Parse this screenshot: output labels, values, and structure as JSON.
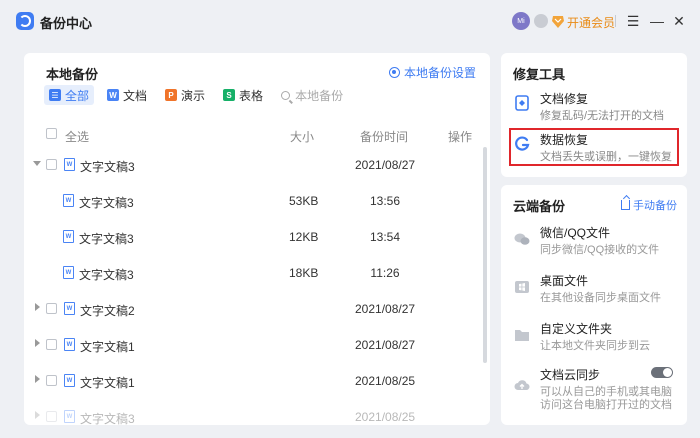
{
  "titlebar": {
    "app_title": "备份中心",
    "avatar_text": "Mi",
    "vip_label": "开通会员",
    "menu_glyph": "☰",
    "minimize_glyph": "—",
    "close_glyph": "✕"
  },
  "local_backup": {
    "title": "本地备份",
    "settings_label": "本地备份设置",
    "filters": [
      {
        "label": "全部",
        "icon_text": "☰"
      },
      {
        "label": "文档",
        "icon_text": "W"
      },
      {
        "label": "演示",
        "icon_text": "P"
      },
      {
        "label": "表格",
        "icon_text": "S"
      }
    ],
    "search_placeholder": "本地备份",
    "columns": {
      "select_all": "全选",
      "size": "大小",
      "time": "备份时间",
      "action": "操作"
    },
    "doc_icon_text": "W",
    "rows": [
      {
        "name": "文字文稿3",
        "size": "",
        "time": "2021/08/27"
      },
      {
        "name": "文字文稿3",
        "size": "53KB",
        "time": "13:56"
      },
      {
        "name": "文字文稿3",
        "size": "12KB",
        "time": "13:54"
      },
      {
        "name": "文字文稿3",
        "size": "18KB",
        "time": "11:26"
      },
      {
        "name": "文字文稿2",
        "size": "",
        "time": "2021/08/27"
      },
      {
        "name": "文字文稿1",
        "size": "",
        "time": "2021/08/27"
      },
      {
        "name": "文字文稿1",
        "size": "",
        "time": "2021/08/25"
      },
      {
        "name": "文字文稿3",
        "size": "",
        "time": "2021/08/25"
      }
    ]
  },
  "repair_tools": {
    "title": "修复工具",
    "items": [
      {
        "title": "文档修复",
        "desc": "修复乱码/无法打开的文档"
      },
      {
        "title": "数据恢复",
        "desc": "文档丢失或误删，一键恢复"
      }
    ]
  },
  "cloud_backup": {
    "title": "云端备份",
    "manual_label": "手动备份",
    "items": [
      {
        "title": "微信/QQ文件",
        "desc": "同步微信/QQ接收的文件"
      },
      {
        "title": "桌面文件",
        "desc": "在其他设备同步桌面文件"
      },
      {
        "title": "自定义文件夹",
        "desc": "让本地文件夹同步到云"
      },
      {
        "title": "文档云同步",
        "desc": "可以从自己的手机或其电脑",
        "desc2": "访问这台电脑打开过的文档"
      }
    ]
  },
  "colors": {
    "accent": "#3f7cf2",
    "highlight_border": "#e0262b",
    "vip": "#e98b16"
  }
}
